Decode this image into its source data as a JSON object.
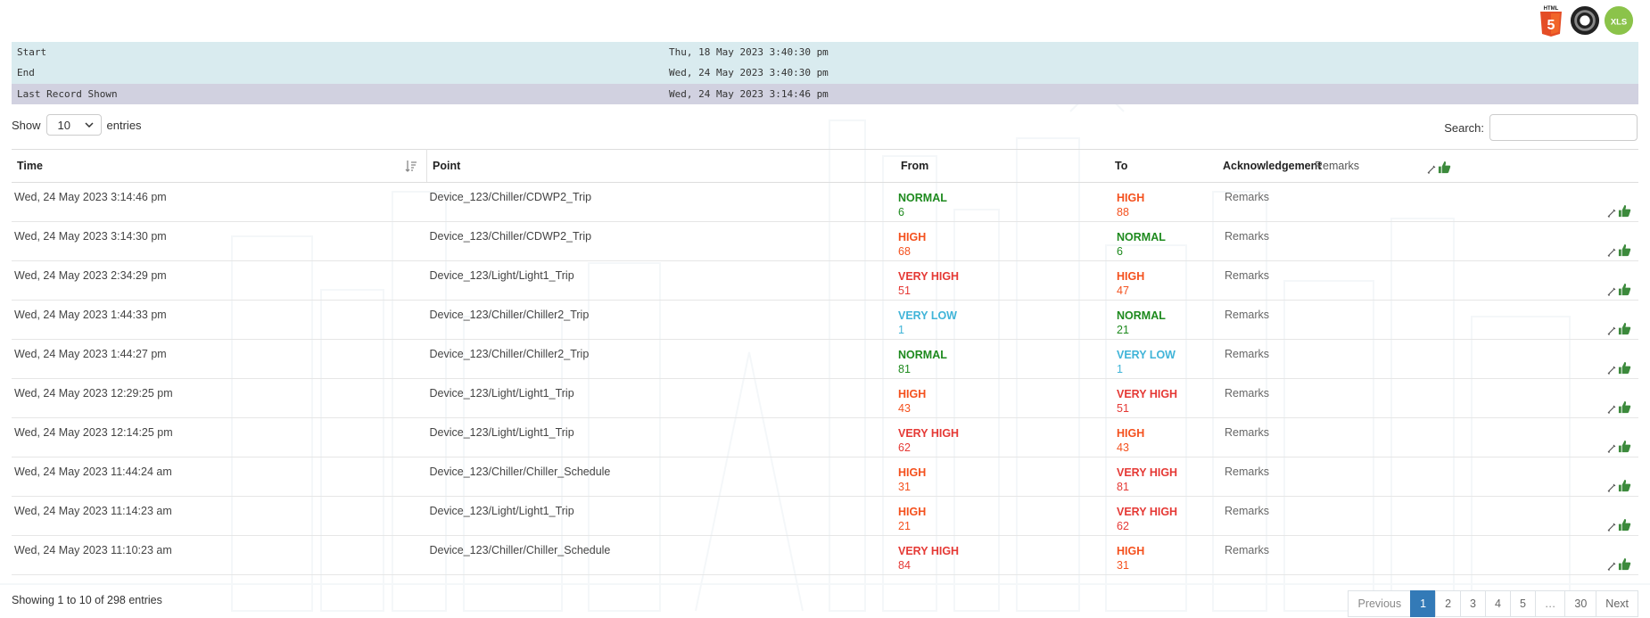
{
  "colors": {
    "normal": "#1e8a1e",
    "high": "#f4511e",
    "very_high": "#e53935",
    "very_low": "#40b4d8",
    "thumb": "#3c8a3c",
    "active_page": "#337ab7"
  },
  "export": {
    "html_icon": "html5-icon",
    "json_icon": "json-icon",
    "xls_icon": "xls-icon",
    "html_label": "HTML",
    "xls_label": "XLS"
  },
  "info": {
    "start_label": "Start",
    "start_value": "Thu, 18 May 2023 3:40:30 pm",
    "end_label": "End",
    "end_value": "Wed, 24 May 2023 3:40:30 pm",
    "last_label": "Last Record Shown",
    "last_value": "Wed, 24 May 2023 3:14:46 pm"
  },
  "controls": {
    "show_label": "Show",
    "entries_value": "10",
    "entries_label": "entries",
    "search_label": "Search:",
    "search_value": ""
  },
  "table": {
    "headers": {
      "time": "Time",
      "point": "Point",
      "from": "From",
      "to": "To",
      "ack": "Acknowledgement",
      "remarks": "Remarks"
    },
    "rows": [
      {
        "time": "Wed, 24 May 2023 3:14:46 pm",
        "point": "Device_123/Chiller/CDWP2_Trip",
        "from_level": "NORMAL",
        "from_value": "6",
        "to_level": "HIGH",
        "to_value": "88",
        "remarks": "Remarks"
      },
      {
        "time": "Wed, 24 May 2023 3:14:30 pm",
        "point": "Device_123/Chiller/CDWP2_Trip",
        "from_level": "HIGH",
        "from_value": "68",
        "to_level": "NORMAL",
        "to_value": "6",
        "remarks": "Remarks"
      },
      {
        "time": "Wed, 24 May 2023 2:34:29 pm",
        "point": "Device_123/Light/Light1_Trip",
        "from_level": "VERY HIGH",
        "from_value": "51",
        "to_level": "HIGH",
        "to_value": "47",
        "remarks": "Remarks"
      },
      {
        "time": "Wed, 24 May 2023 1:44:33 pm",
        "point": "Device_123/Chiller/Chiller2_Trip",
        "from_level": "VERY LOW",
        "from_value": "1",
        "to_level": "NORMAL",
        "to_value": "21",
        "remarks": "Remarks"
      },
      {
        "time": "Wed, 24 May 2023 1:44:27 pm",
        "point": "Device_123/Chiller/Chiller2_Trip",
        "from_level": "NORMAL",
        "from_value": "81",
        "to_level": "VERY LOW",
        "to_value": "1",
        "remarks": "Remarks"
      },
      {
        "time": "Wed, 24 May 2023 12:29:25 pm",
        "point": "Device_123/Light/Light1_Trip",
        "from_level": "HIGH",
        "from_value": "43",
        "to_level": "VERY HIGH",
        "to_value": "51",
        "remarks": "Remarks"
      },
      {
        "time": "Wed, 24 May 2023 12:14:25 pm",
        "point": "Device_123/Light/Light1_Trip",
        "from_level": "VERY HIGH",
        "from_value": "62",
        "to_level": "HIGH",
        "to_value": "43",
        "remarks": "Remarks"
      },
      {
        "time": "Wed, 24 May 2023 11:44:24 am",
        "point": "Device_123/Chiller/Chiller_Schedule",
        "from_level": "HIGH",
        "from_value": "31",
        "to_level": "VERY HIGH",
        "to_value": "81",
        "remarks": "Remarks"
      },
      {
        "time": "Wed, 24 May 2023 11:14:23 am",
        "point": "Device_123/Light/Light1_Trip",
        "from_level": "HIGH",
        "from_value": "21",
        "to_level": "VERY HIGH",
        "to_value": "62",
        "remarks": "Remarks"
      },
      {
        "time": "Wed, 24 May 2023 11:10:23 am",
        "point": "Device_123/Chiller/Chiller_Schedule",
        "from_level": "VERY HIGH",
        "from_value": "84",
        "to_level": "HIGH",
        "to_value": "31",
        "remarks": "Remarks"
      }
    ]
  },
  "footer": {
    "info": "Showing 1 to 10 of 298 entries",
    "previous": "Previous",
    "pages": [
      "1",
      "2",
      "3",
      "4",
      "5",
      "…",
      "30"
    ],
    "active_page": "1",
    "next": "Next"
  }
}
